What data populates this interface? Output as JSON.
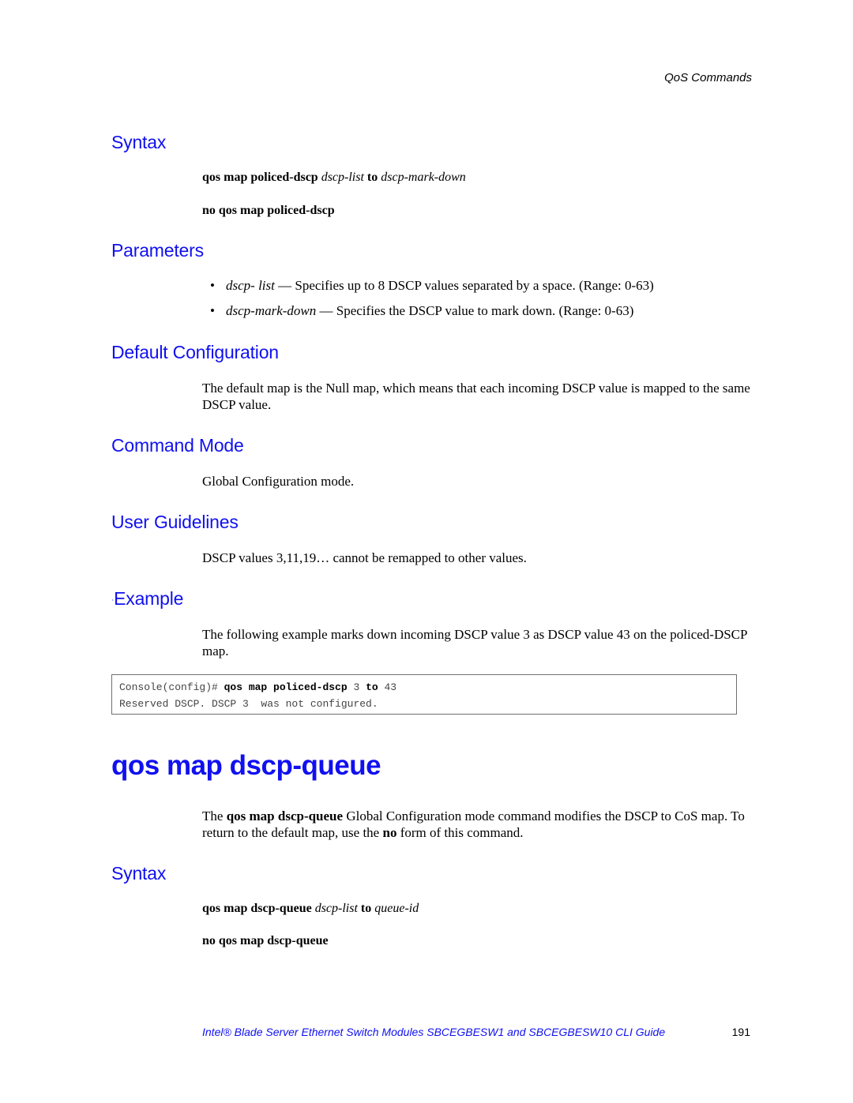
{
  "header": {
    "running_title": "QoS Commands"
  },
  "section1": {
    "syntax": {
      "heading": "Syntax",
      "line1": {
        "cmd": "qos map policed-dscp",
        "arg1": "dscp-list",
        "kw": "to",
        "arg2": "dscp-mark-down"
      },
      "line2": "no qos map policed-dscp"
    },
    "parameters": {
      "heading": "Parameters",
      "items": [
        {
          "bullet": "•",
          "term": "dscp- list",
          "desc": " — Specifies up to 8 DSCP values separated by a space. (Range: 0-63)"
        },
        {
          "bullet": "•",
          "term": "dscp-mark-down",
          "desc": " — Specifies the DSCP value to mark down. (Range: 0-63)"
        }
      ]
    },
    "default_configuration": {
      "heading": "Default Configuration",
      "text": "The default map is the Null map, which means that each incoming DSCP value is mapped to the same DSCP value."
    },
    "command_mode": {
      "heading": "Command Mode",
      "text": "Global Configuration mode."
    },
    "user_guidelines": {
      "heading": "User Guidelines",
      "text": "DSCP values 3,11,19… cannot be remapped to other values."
    },
    "example": {
      "marker": "·",
      "heading": "Example",
      "text": "The following example marks down incoming DSCP value 3 as DSCP value 43 on the policed-DSCP map.",
      "code": {
        "prompt": "Console(config)# ",
        "cmd1": "qos map policed-dscp",
        "v1": " 3 ",
        "kw": "to",
        "v2": " 43",
        "output": "Reserved DSCP. DSCP 3  was not configured."
      }
    }
  },
  "section2": {
    "title": "qos map dscp-queue",
    "description": {
      "pre": "The ",
      "cmd": "qos map dscp-queue",
      "mid": " Global Configuration mode command modifies the DSCP to CoS map. To return to the default map, use the ",
      "no": "no",
      "post": " form of this command."
    },
    "syntax": {
      "heading": "Syntax",
      "line1": {
        "cmd": "qos map dscp-queue",
        "arg1": "dscp-list",
        "kw": "to",
        "arg2": "queue-id"
      },
      "line2": "no qos map dscp-queue"
    }
  },
  "footer": {
    "title": "Intel® Blade Server Ethernet Switch Modules SBCEGBESW1 and SBCEGBESW10 CLI Guide",
    "page_number": "191"
  }
}
